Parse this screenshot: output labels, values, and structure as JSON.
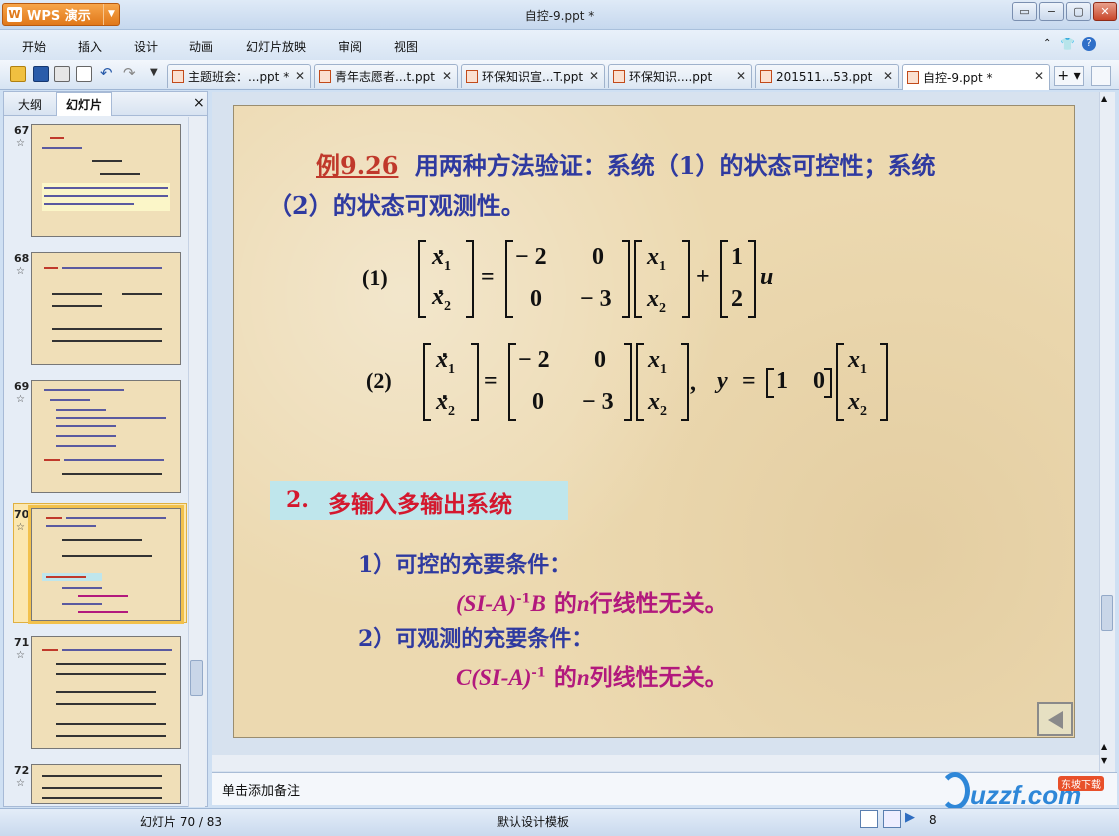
{
  "window": {
    "app_button": "WPS 演示",
    "title": "自控-9.ppt *",
    "buttons": [
      "▭",
      "−",
      "▢",
      "✕"
    ]
  },
  "menu": [
    "开始",
    "插入",
    "设计",
    "动画",
    "幻灯片放映",
    "审阅",
    "视图"
  ],
  "tabs": [
    {
      "label": "主题班会：...ppt *"
    },
    {
      "label": "青年志愿者...t.ppt"
    },
    {
      "label": "环保知识宣...T.ppt"
    },
    {
      "label": "环保知识....ppt"
    },
    {
      "label": "201511...53.ppt"
    },
    {
      "label": "自控-9.ppt *"
    }
  ],
  "panel": {
    "tab_outline": "大纲",
    "tab_slides": "幻灯片",
    "close": "×"
  },
  "thumbnails": [
    {
      "num": "67",
      "star": "☆"
    },
    {
      "num": "68",
      "star": "☆"
    },
    {
      "num": "69",
      "star": "☆"
    },
    {
      "num": "70",
      "star": "☆"
    },
    {
      "num": "71",
      "star": "☆"
    },
    {
      "num": "72",
      "star": "☆"
    }
  ],
  "slide": {
    "example_label": "例9.26",
    "intro_line1": "用两种方法验证：系统（1）的状态可控性；系统",
    "intro_line2": "（2）的状态可观测性。",
    "eq1_label": "(1)",
    "eq2_label": "(2)",
    "section_num": "2.",
    "section_title": "多输入多输出系统",
    "cond1_title": "1）可控的充要条件：",
    "cond1_body_a": "(SI-A)",
    "cond1_sup": "-1",
    "cond1_body_b": "B",
    "cond1_body_c": " 的",
    "cond1_n": "n",
    "cond1_body_d": "行线性无关。",
    "cond2_title": "2）可观测的充要条件：",
    "cond2_body_a": "C(SI-A)",
    "cond2_sup": "-1",
    "cond2_body_c": " 的",
    "cond2_n": "n",
    "cond2_body_d": "列线性无关。",
    "eq": {
      "x1": "x",
      "sub1": "1",
      "sub2": "2",
      "a11": "− 2",
      "a12": "0",
      "a21": "0",
      "a22": "− 3",
      "b1": "1",
      "b2": "2",
      "u": "u",
      "y": "y",
      "c1": "1",
      "c2": "0",
      "plus": "+",
      "eqs": "=",
      "comma": ","
    }
  },
  "notes_placeholder": "单击添加备注",
  "status": {
    "slide_count": "幻灯片 70 / 83",
    "template": "默认设计模板",
    "zoom": "8"
  },
  "watermark": {
    "text": "uzzf.com",
    "tag": "东坡下载"
  },
  "icons": {
    "toolbar": [
      "open-icon",
      "save-icon",
      "print-icon",
      "preview-icon",
      "undo-icon",
      "redo-icon"
    ],
    "brand_orange": "#e0781a"
  }
}
